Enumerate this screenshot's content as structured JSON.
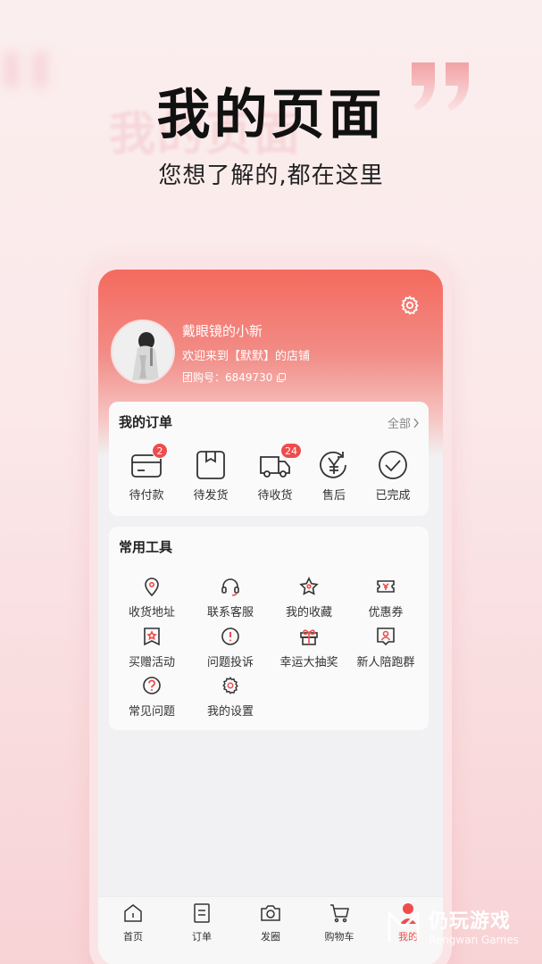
{
  "hero": {
    "title": "我的页面",
    "subtitle": "您想了解的,都在这里"
  },
  "profile": {
    "name": "戴眼镜的小新",
    "welcome": "欢迎来到【默默】的店铺",
    "group_id_label": "团购号：6849730"
  },
  "orders": {
    "title": "我的订单",
    "all_label": "全部",
    "items": [
      {
        "label": "待付款",
        "badge": "2",
        "icon": "wallet-card-icon"
      },
      {
        "label": "待发货",
        "badge": "",
        "icon": "package-box-icon"
      },
      {
        "label": "待收货",
        "badge": "24",
        "icon": "delivery-truck-icon"
      },
      {
        "label": "售后",
        "badge": "",
        "icon": "yen-refund-icon"
      },
      {
        "label": "已完成",
        "badge": "",
        "icon": "check-circle-icon"
      }
    ]
  },
  "tools": {
    "title": "常用工具",
    "items": [
      {
        "label": "收货地址",
        "icon": "location-pin-icon"
      },
      {
        "label": "联系客服",
        "icon": "headset-icon"
      },
      {
        "label": "我的收藏",
        "icon": "star-icon"
      },
      {
        "label": "优惠券",
        "icon": "coupon-icon"
      },
      {
        "label": "买赠活动",
        "icon": "gift-tag-icon"
      },
      {
        "label": "问题投诉",
        "icon": "alert-circle-icon"
      },
      {
        "label": "幸运大抽奖",
        "icon": "gift-box-icon"
      },
      {
        "label": "新人陪跑群",
        "icon": "user-badge-icon"
      },
      {
        "label": "常见问题",
        "icon": "question-circle-icon"
      },
      {
        "label": "我的设置",
        "icon": "gear-icon"
      }
    ]
  },
  "tabbar": {
    "items": [
      {
        "label": "首页",
        "icon": "home-icon"
      },
      {
        "label": "订单",
        "icon": "order-list-icon"
      },
      {
        "label": "发圈",
        "icon": "camera-icon"
      },
      {
        "label": "购物车",
        "icon": "cart-icon"
      },
      {
        "label": "我的",
        "icon": "profile-icon",
        "active": true
      }
    ]
  },
  "watermark": {
    "title": "仍玩游戏",
    "subtitle": "Rengwan Games"
  },
  "colors": {
    "accent": "#ef4c4c",
    "header_top": "#f46a5e"
  }
}
